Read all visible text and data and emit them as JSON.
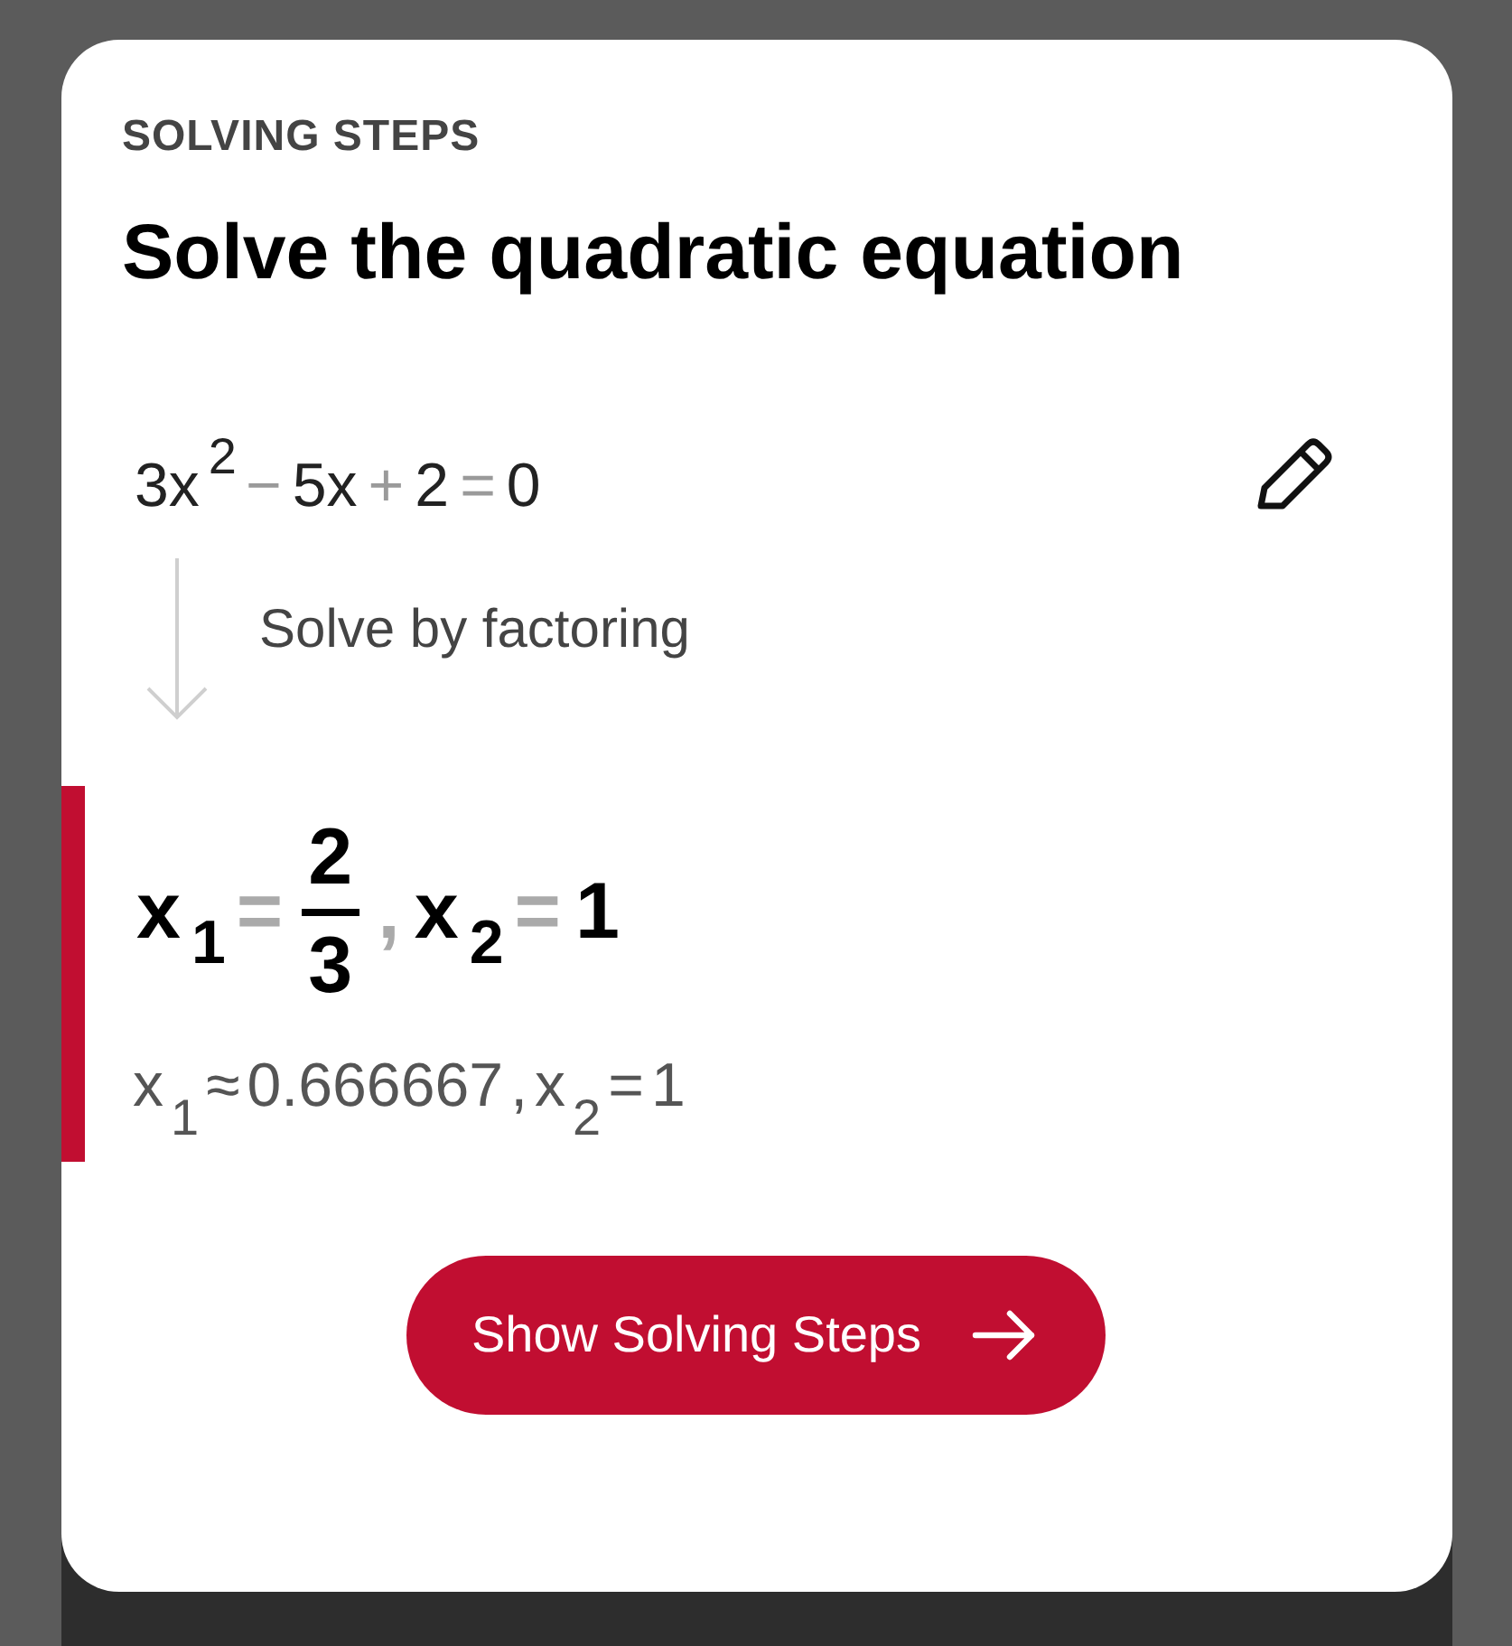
{
  "header": "SOLVING STEPS",
  "title": "Solve the quadratic equation",
  "equation": [
    {
      "kind": "term",
      "text": "3x"
    },
    {
      "kind": "sup",
      "text": "2"
    },
    {
      "kind": "op",
      "text": "−"
    },
    {
      "kind": "term",
      "text": "5x"
    },
    {
      "kind": "op",
      "text": "+"
    },
    {
      "kind": "term",
      "text": "2"
    },
    {
      "kind": "op",
      "text": "="
    },
    {
      "kind": "term",
      "text": "0"
    }
  ],
  "method": "Solve by factoring",
  "exact_result": [
    {
      "kind": "term",
      "text": "x"
    },
    {
      "kind": "sub",
      "text": "1"
    },
    {
      "kind": "op",
      "text": "="
    },
    {
      "kind": "frac",
      "numerator": "2",
      "denominator": "3"
    },
    {
      "kind": "op",
      "text": ","
    },
    {
      "kind": "term",
      "text": "x"
    },
    {
      "kind": "sub",
      "text": "2"
    },
    {
      "kind": "op",
      "text": "="
    },
    {
      "kind": "term",
      "text": "1"
    }
  ],
  "approx_result": [
    {
      "kind": "term",
      "text": "x"
    },
    {
      "kind": "sub",
      "text": "1"
    },
    {
      "kind": "term",
      "text": "≈"
    },
    {
      "kind": "term",
      "text": "0.666667"
    },
    {
      "kind": "term",
      "text": ","
    },
    {
      "kind": "term",
      "text": "x"
    },
    {
      "kind": "sub",
      "text": "2"
    },
    {
      "kind": "term",
      "text": "="
    },
    {
      "kind": "term",
      "text": "1"
    }
  ],
  "button": "Show Solving Steps"
}
